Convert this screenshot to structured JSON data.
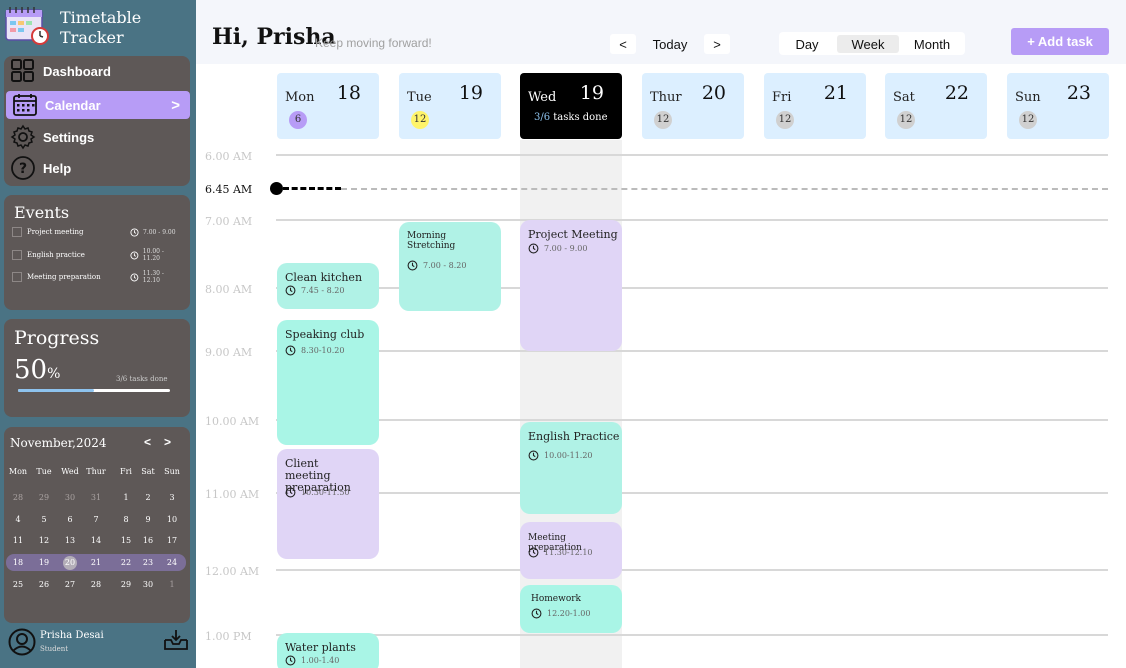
{
  "app": {
    "title": "Timetable Tracker"
  },
  "nav": [
    {
      "label": "Dashboard",
      "icon": "grid-icon"
    },
    {
      "label": "Calendar",
      "icon": "calendar-icon",
      "chevron": ">"
    },
    {
      "label": "Settings",
      "icon": "gear-icon"
    },
    {
      "label": "Help",
      "icon": "question-icon"
    }
  ],
  "events": {
    "title": "Events",
    "items": [
      {
        "label": "Project meeting",
        "time": "7.00 - 9.00"
      },
      {
        "label": "English practice",
        "time": "10.00 - 11.20"
      },
      {
        "label": "Meeting preparation",
        "time": "11.30 - 12.10"
      }
    ]
  },
  "progress": {
    "title": "Progress",
    "percent": "50",
    "unit": "%",
    "done_text": "3/6 tasks done",
    "fraction": 0.5
  },
  "mini_calendar": {
    "title": "November,2024",
    "prev": "<",
    "next": ">",
    "dow": [
      "Mon",
      "Tue",
      "Wed",
      "Thur",
      "Fri",
      "Sat",
      "Sun"
    ],
    "weeks": [
      [
        "28",
        "29",
        "30",
        "31",
        "1",
        "2",
        "3"
      ],
      [
        "4",
        "5",
        "6",
        "7",
        "8",
        "9",
        "10"
      ],
      [
        "11",
        "12",
        "13",
        "14",
        "15",
        "16",
        "17"
      ],
      [
        "18",
        "19",
        "20",
        "21",
        "22",
        "23",
        "24"
      ],
      [
        "25",
        "26",
        "27",
        "28",
        "29",
        "30",
        "1"
      ]
    ]
  },
  "user": {
    "name": "Prisha Desai",
    "role": "Student"
  },
  "header": {
    "greeting": "Hi, Prisha",
    "subtitle": "Keep moving forward!",
    "prev": "<",
    "today": "Today",
    "next": ">",
    "views": [
      "Day",
      "Week",
      "Month"
    ],
    "active_view": "Week",
    "add_task": "+ Add task"
  },
  "days": [
    {
      "name": "Mon",
      "num": "18",
      "count": "6",
      "count_color": "#b79cf6"
    },
    {
      "name": "Tue",
      "num": "19",
      "count": "12",
      "count_color": "#fff46a"
    },
    {
      "name": "Wed",
      "num": "19",
      "done_a": "3/6",
      "done_b": " tasks done"
    },
    {
      "name": "Thur",
      "num": "20",
      "count": "12"
    },
    {
      "name": "Fri",
      "num": "21",
      "count": "12"
    },
    {
      "name": "Sat",
      "num": "22",
      "count": "12"
    },
    {
      "name": "Sun",
      "num": "23",
      "count": "12"
    }
  ],
  "times": [
    "6.00 AM",
    "7.00 AM",
    "8.00 AM",
    "9.00 AM",
    "10.00 AM",
    "11.00 AM",
    "12.00 AM",
    "1.00 PM"
  ],
  "now": "6.45 AM",
  "tasks": [
    {
      "title": "Morning Stretching",
      "time": "7.00 - 8.20"
    },
    {
      "title": "Project Meeting",
      "time": "7.00 - 9.00"
    },
    {
      "title": "Clean kitchen",
      "time": "7.45 - 8.20"
    },
    {
      "title": "Speaking club",
      "time": "8.30-10.20"
    },
    {
      "title": "English Practice",
      "time": "10.00-11.20"
    },
    {
      "title": "Client meeting preparation",
      "time": "10.30-11.50"
    },
    {
      "title": "Meeting preparation",
      "time": "11.30-12.10"
    },
    {
      "title": "Homework",
      "time": "12.20-1.00"
    },
    {
      "title": "Water plants",
      "time": "1.00-1.40"
    }
  ]
}
